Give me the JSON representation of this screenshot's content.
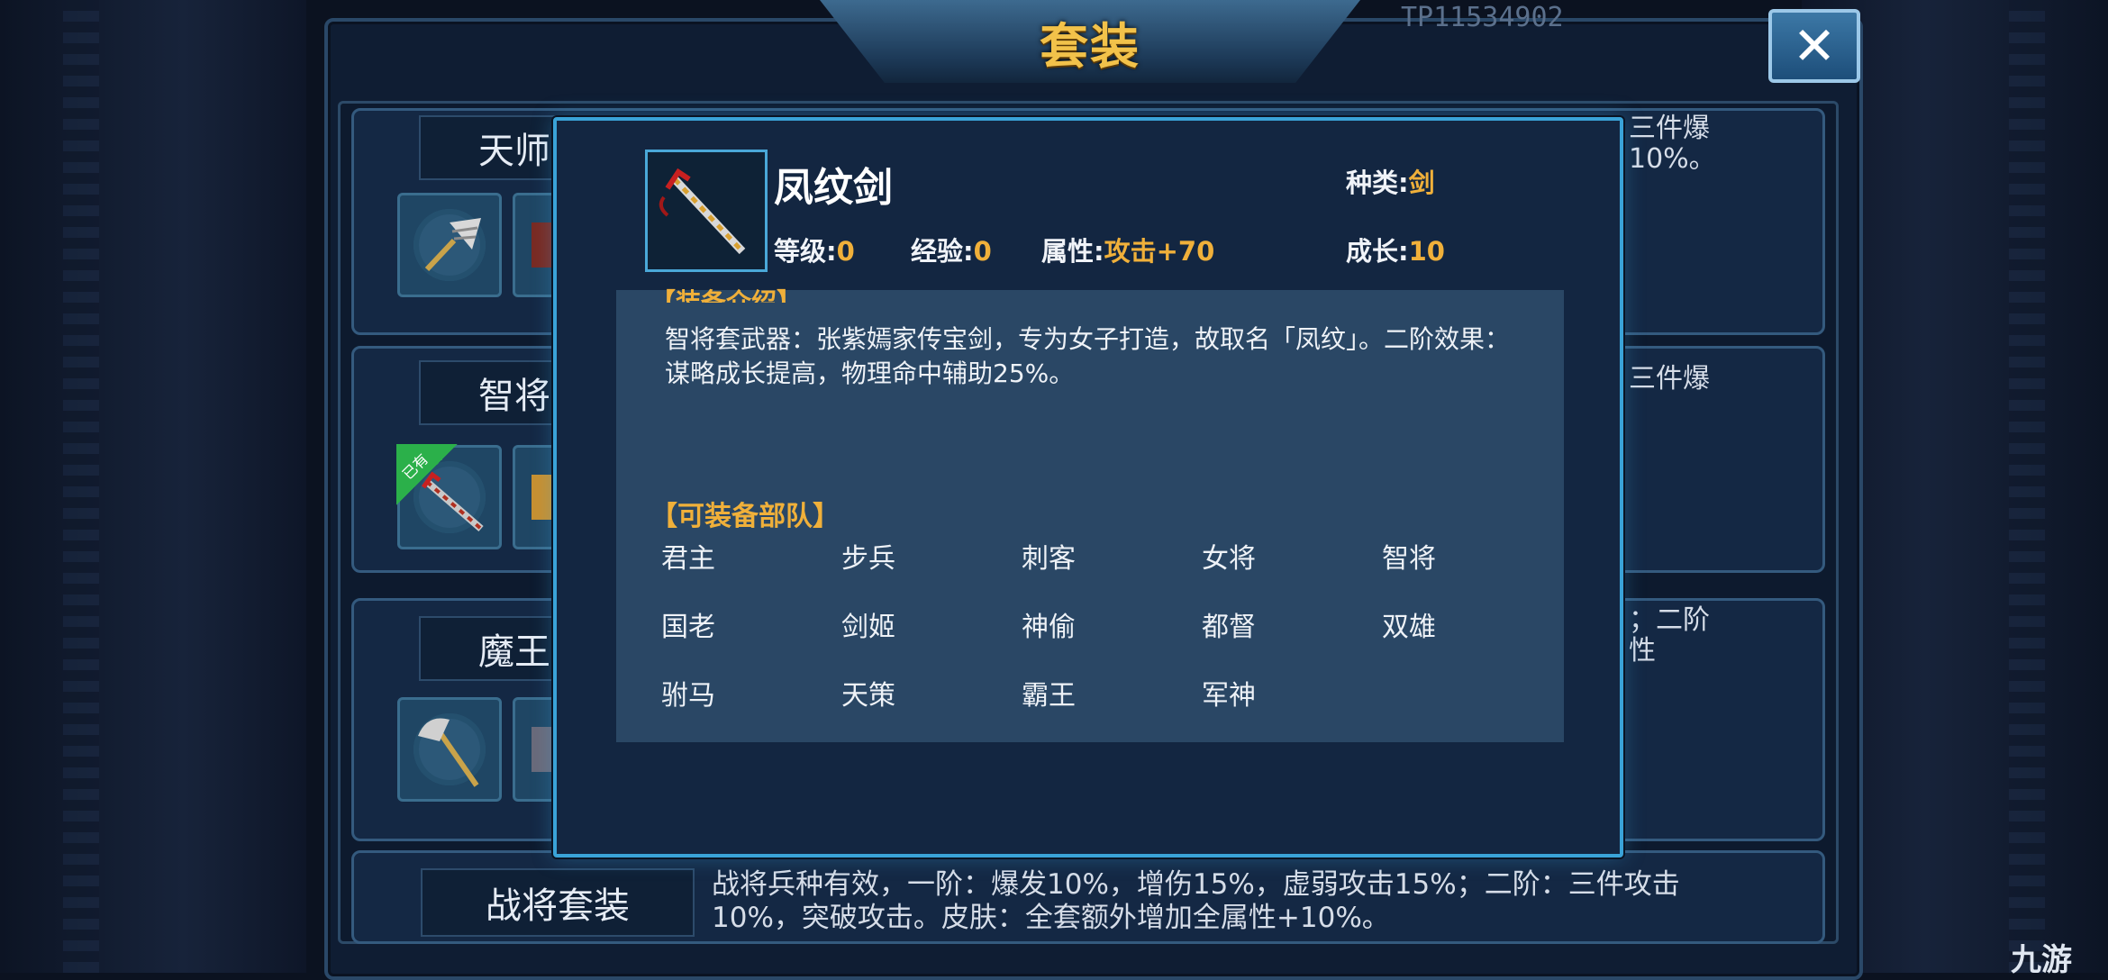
{
  "window": {
    "title": "套装",
    "title_id": "TP11534902",
    "close_label": "✕"
  },
  "set_rows": [
    {
      "name": "天师",
      "right_text": [
        "三件爆",
        "10%。"
      ]
    },
    {
      "name": "智将",
      "right_text": [
        "三件爆"
      ],
      "owned_tag": "已有"
    },
    {
      "name": "魔王",
      "right_text": [
        "；二阶",
        "性"
      ]
    }
  ],
  "bottom_row": {
    "name": "战将套装",
    "description": "战将兵种有效，一阶：爆发10%，增伤15%，虚弱攻击15%；二阶：三件攻击10%，突破攻击。皮肤：全套额外增加全属性+10%。"
  },
  "popup": {
    "item_name": "凤纹剑",
    "stats": {
      "type_label": "种类:",
      "type_value": "剑",
      "level_label": "等级:",
      "level_value": "0",
      "exp_label": "经验:",
      "exp_value": "0",
      "attr_label": "属性:",
      "attr_value": "攻击+70",
      "growth_label": "成长:",
      "growth_value": "10"
    },
    "intro_header": "【装备介绍】",
    "intro_text": "智将套武器：张紫嫣家传宝剑，专为女子打造，故取名「凤纹」。二阶效果：谋略成长提高，物理命中辅助25%。",
    "troops_header": "【可装备部队】",
    "troops": [
      "君主",
      "步兵",
      "刺客",
      "女将",
      "智将",
      "国老",
      "剑姬",
      "神偷",
      "都督",
      "双雄",
      "驸马",
      "天策",
      "霸王",
      "军神"
    ]
  },
  "watermark": "九游",
  "colors": {
    "accent_gold": "#f0b03a",
    "popup_border": "#3aa3d8",
    "owned_green": "#2bb04a"
  }
}
